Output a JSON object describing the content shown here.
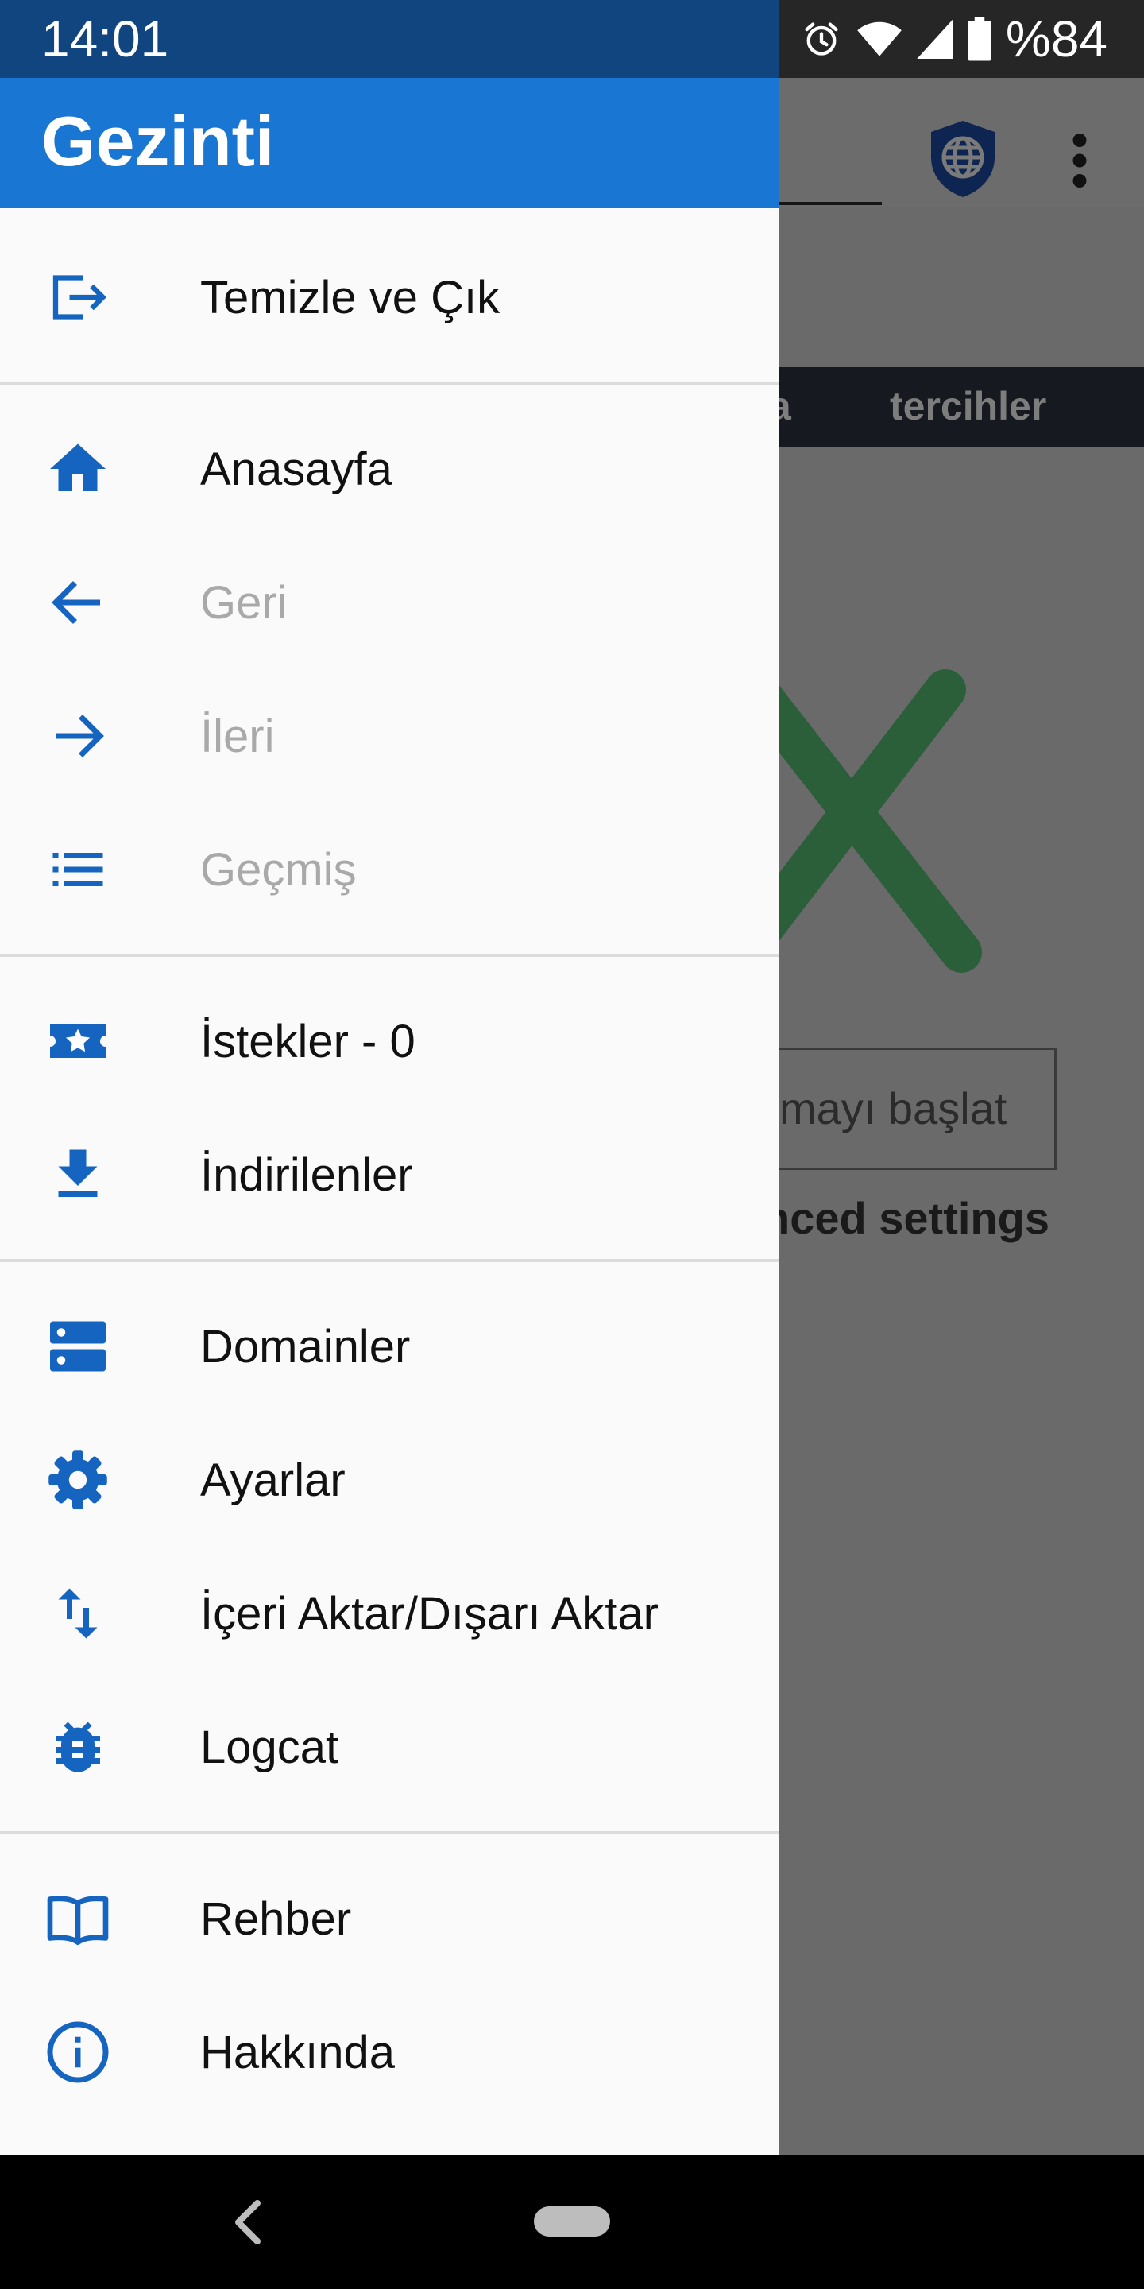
{
  "status_bar": {
    "time": "14:01",
    "battery": "%84",
    "icons": [
      "alarm-icon",
      "wifi-icon",
      "signal-icon",
      "battery-icon"
    ]
  },
  "background": {
    "tab_partial": "a",
    "tab_preferences": "tercihler",
    "start_button": "mayı başlat",
    "advanced_settings": "nced settings"
  },
  "drawer": {
    "title": "Gezinti",
    "accent": "#1976d2",
    "sections": [
      [
        {
          "label": "Temizle ve Çık",
          "icon": "exit-icon",
          "enabled": true
        }
      ],
      [
        {
          "label": "Anasayfa",
          "icon": "home-icon",
          "enabled": true
        },
        {
          "label": "Geri",
          "icon": "arrow-back-icon",
          "enabled": false
        },
        {
          "label": "İleri",
          "icon": "arrow-forward-icon",
          "enabled": false
        },
        {
          "label": "Geçmiş",
          "icon": "history-list-icon",
          "enabled": false
        }
      ],
      [
        {
          "label": "İstekler - 0",
          "icon": "requests-star-icon",
          "enabled": true
        },
        {
          "label": "İndirilenler",
          "icon": "download-icon",
          "enabled": true
        }
      ],
      [
        {
          "label": "Domainler",
          "icon": "domains-icon",
          "enabled": true
        },
        {
          "label": "Ayarlar",
          "icon": "settings-gear-icon",
          "enabled": true
        },
        {
          "label": "İçeri Aktar/Dışarı Aktar",
          "icon": "import-export-icon",
          "enabled": true
        },
        {
          "label": "Logcat",
          "icon": "bug-icon",
          "enabled": true
        }
      ],
      [
        {
          "label": "Rehber",
          "icon": "guide-book-icon",
          "enabled": true
        },
        {
          "label": "Hakkında",
          "icon": "info-icon",
          "enabled": true
        }
      ]
    ]
  }
}
